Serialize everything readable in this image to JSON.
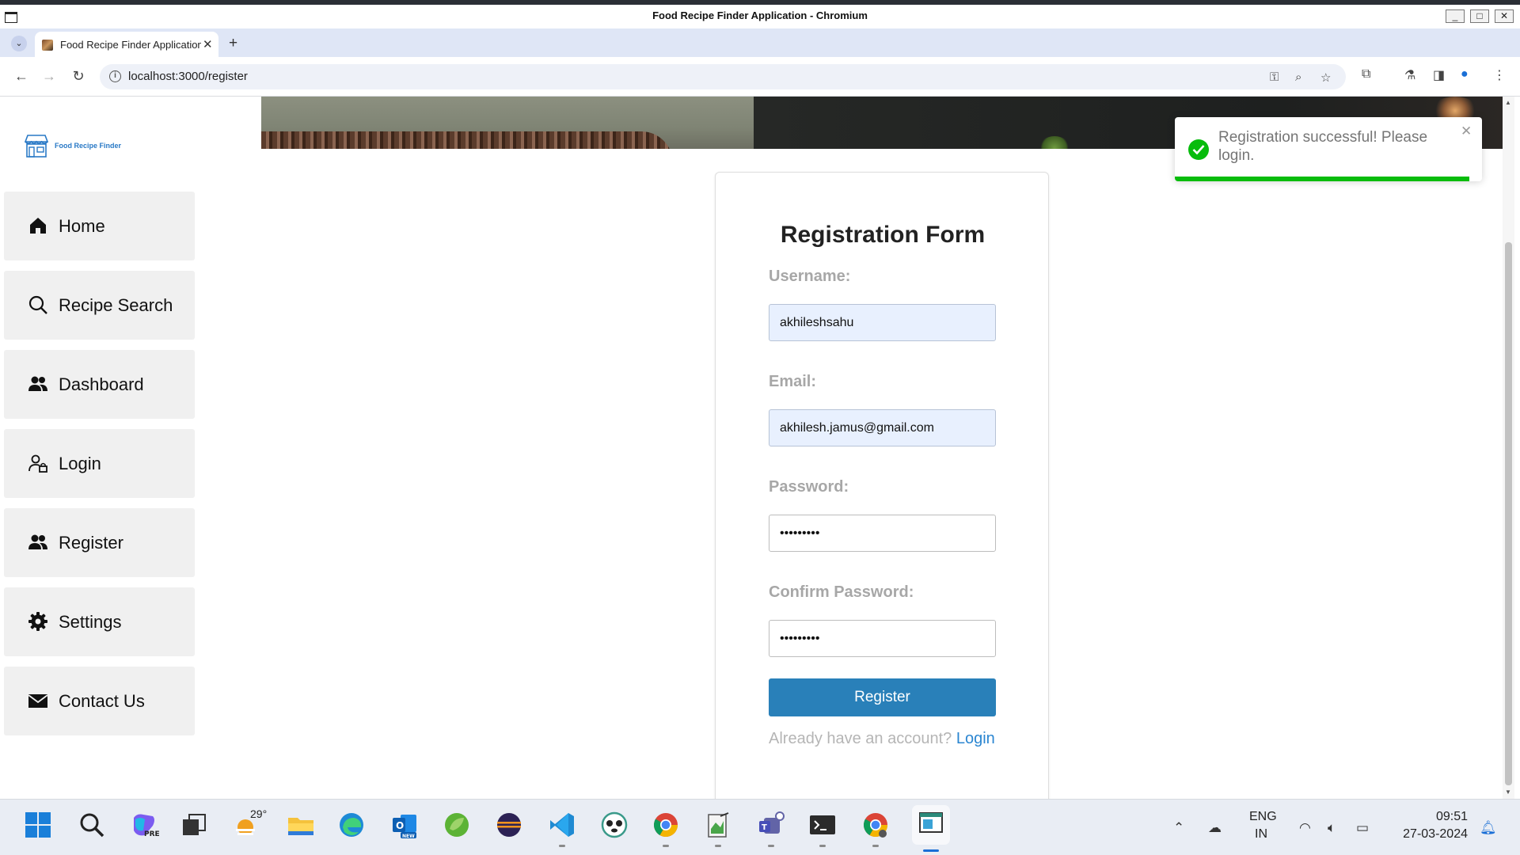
{
  "window": {
    "title": "Food Recipe Finder Application - Chromium",
    "controls": [
      "_",
      "□",
      "✕"
    ]
  },
  "browser": {
    "tab_title": "Food Recipe Finder Application",
    "tab_close": "✕",
    "new_tab": "+",
    "url": "localhost:3000/register",
    "icons": [
      "back-icon",
      "forward-icon",
      "reload-icon",
      "site-info-icon",
      "key-icon",
      "zoom-icon",
      "bookmark-star-icon",
      "extensions-icon",
      "lab-flask-icon",
      "side-panel-icon",
      "profile-icon",
      "kebab-menu-icon"
    ]
  },
  "brand": {
    "name": "Food Recipe Finder",
    "color": "#2979c6"
  },
  "sidebar": {
    "items": [
      {
        "label": "Home",
        "icon": "home-icon"
      },
      {
        "label": "Recipe Search",
        "icon": "search-icon"
      },
      {
        "label": "Dashboard",
        "icon": "users-icon"
      },
      {
        "label": "Login",
        "icon": "user-lock-icon"
      },
      {
        "label": "Register",
        "icon": "users-icon"
      },
      {
        "label": "Settings",
        "icon": "gear-icon"
      },
      {
        "label": "Contact Us",
        "icon": "envelope-icon"
      }
    ]
  },
  "form": {
    "title": "Registration Form",
    "username_label": "Username:",
    "username_value": "akhileshsahu",
    "email_label": "Email:",
    "email_value": "akhilesh.jamus@gmail.com",
    "password_label": "Password:",
    "password_value": "•••••••••",
    "confirm_label": "Confirm Password:",
    "confirm_value": "•••••••••",
    "submit_label": "Register",
    "login_prompt": "Already have an account?",
    "login_link": "Login",
    "button_color": "#2980b9"
  },
  "toast": {
    "message": "Registration successful! Please login.",
    "close": "✕",
    "progress": 0.96,
    "color": "#07bc0c"
  },
  "taskbar": {
    "weather": "29°",
    "apps": [
      "windows-start-icon",
      "search-icon",
      "copilot-icon",
      "task-view-icon",
      "weather-icon",
      "file-explorer-icon",
      "edge-icon",
      "outlook-icon",
      "spring-icon",
      "eclipse-icon",
      "vscode-icon",
      "panda-app-icon",
      "chrome-icon",
      "notepad-icon",
      "teams-icon",
      "terminal-icon",
      "chrome-dev-icon",
      "active-app-icon"
    ],
    "language": "ENG",
    "region": "IN",
    "time": "09:51",
    "date": "27-03-2024"
  }
}
